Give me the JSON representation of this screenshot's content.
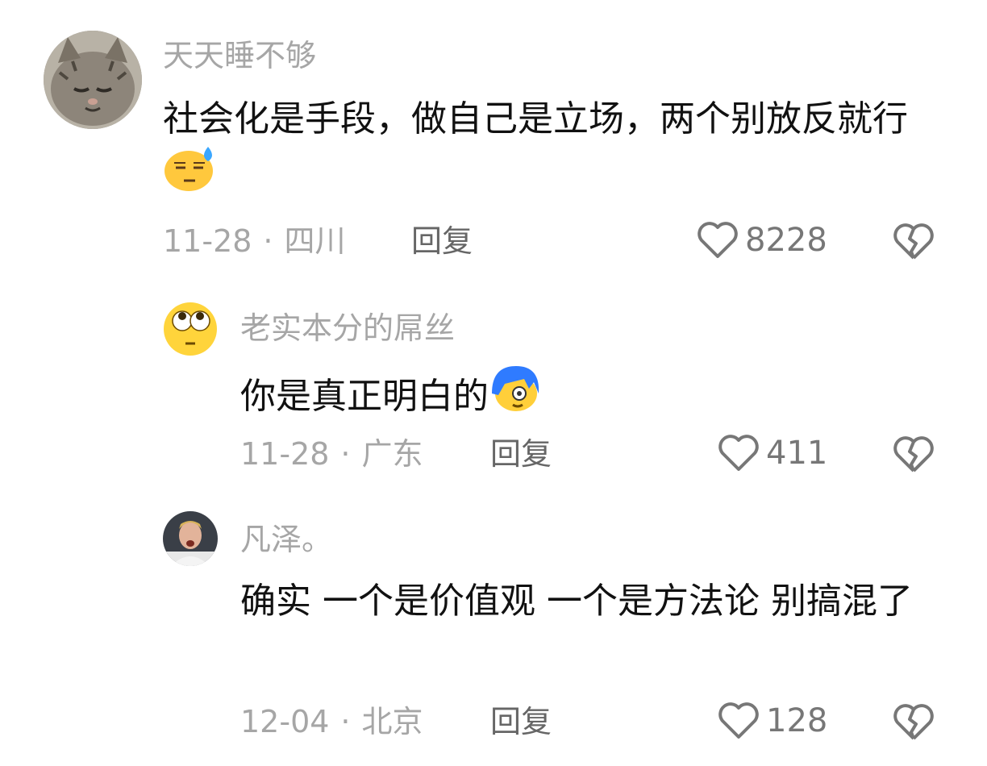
{
  "comments": [
    {
      "username": "天天睡不够",
      "text": "社会化是手段，做自己是立场，两个别放反就行",
      "emoji": "downcast-sweat-emoji",
      "date": "11-28",
      "location": "四川",
      "reply_label": "回复",
      "likes": "8228",
      "avatar": "cat-photo-avatar"
    },
    {
      "username": "老实本分的屌丝",
      "text": "你是真正明白的",
      "emoji": "blue-hair-face-emoji",
      "date": "11-28",
      "location": "广东",
      "reply_label": "回复",
      "likes": "411",
      "avatar": "rolling-eyes-emoji-avatar"
    },
    {
      "username": "凡泽。",
      "text": "确实 一个是价值观 一个是方法论 别搞混了",
      "date": "12-04",
      "location": "北京",
      "reply_label": "回复",
      "likes": "128",
      "avatar": "footballer-photo-avatar"
    }
  ],
  "colors": {
    "meta_gray": "#a6a6a6",
    "text_black": "#111111",
    "icon_gray": "#777777"
  }
}
